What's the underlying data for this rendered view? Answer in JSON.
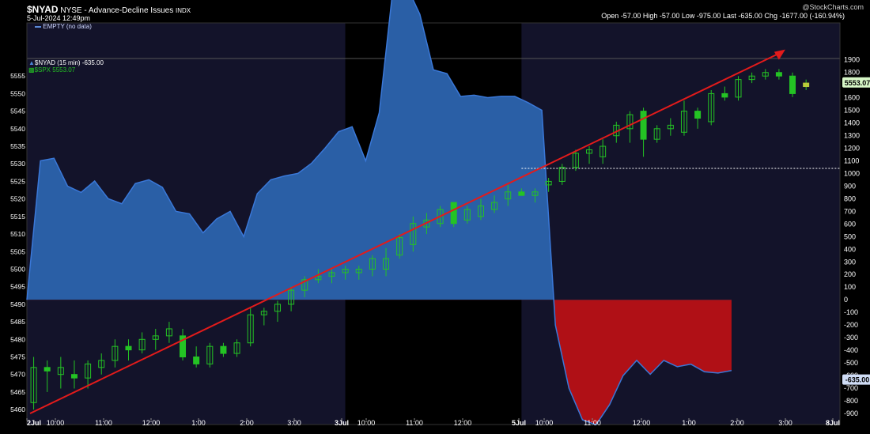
{
  "header": {
    "symbol": "$NYAD",
    "description": "NYSE - Advance-Decline Issues",
    "exchange": "INDX",
    "date": "5-Jul-2024 12:49pm",
    "ohlc": "Open -57.00   High -57.00   Low -975.00   Last -635.00   Chg -1677.00 (-160.94%)",
    "watermark": "@StockCharts.com"
  },
  "top_panel": {
    "legend": "EMPTY (no data)"
  },
  "legend": {
    "nyad": "$NYAD (15 min) -635.00",
    "spx": "$SPX 5553.07"
  },
  "colors": {
    "area_pos": "#2a5fa6",
    "area_neg": "#b01016",
    "candle_up": "#24c324",
    "trend": "#e31b1b",
    "bg_dark": "#13132a",
    "bg_black": "#000000"
  },
  "chart_data": {
    "type": "area",
    "title": "$NYAD NYSE - Advance-Decline Issues",
    "series": [
      {
        "name": "$NYAD (15 min)",
        "type": "area",
        "values": [
          0,
          1100,
          1120,
          900,
          850,
          940,
          800,
          760,
          920,
          950,
          890,
          700,
          680,
          530,
          640,
          700,
          500,
          840,
          950,
          980,
          1000,
          1080,
          1200,
          1330,
          1370,
          1100,
          1480,
          2450,
          2490,
          2260,
          1820,
          1790,
          1610,
          1620,
          1600,
          1610,
          1610,
          1560,
          1500,
          -200,
          -700,
          -950,
          -990,
          -830,
          -600,
          -480,
          -590,
          -480,
          -530,
          -510,
          -570,
          -580,
          -560
        ],
        "last": -635.0
      },
      {
        "name": "$SPX",
        "type": "candlestick",
        "candles": [
          [
            5462,
            5472,
            5460,
            5475
          ],
          [
            5472,
            5471,
            5465,
            5474
          ],
          [
            5470,
            5472,
            5466,
            5475
          ],
          [
            5470,
            5469,
            5466,
            5474
          ],
          [
            5469,
            5473,
            5466,
            5474
          ],
          [
            5472,
            5474,
            5470,
            5476
          ],
          [
            5474,
            5478,
            5472,
            5480
          ],
          [
            5478,
            5477,
            5474,
            5480
          ],
          [
            5477,
            5480,
            5476,
            5482
          ],
          [
            5480,
            5481,
            5477,
            5483
          ],
          [
            5481,
            5483,
            5479,
            5485
          ],
          [
            5481,
            5475,
            5474,
            5483
          ],
          [
            5475,
            5473,
            5472,
            5478
          ],
          [
            5473,
            5478,
            5472,
            5479
          ],
          [
            5478,
            5476,
            5475,
            5479
          ],
          [
            5476,
            5479,
            5475,
            5480
          ],
          [
            5479,
            5487,
            5478,
            5489
          ],
          [
            5487,
            5488,
            5484,
            5489
          ],
          [
            5488,
            5490,
            5485,
            5491
          ],
          [
            5490,
            5494,
            5488,
            5495
          ],
          [
            5494,
            5497,
            5492,
            5498
          ],
          [
            5497,
            5498,
            5496,
            5500
          ],
          [
            5498,
            5499,
            5496,
            5500
          ],
          [
            5499,
            5500,
            5497,
            5501
          ],
          [
            5499,
            5500,
            5497,
            5501
          ],
          [
            5500,
            5503,
            5498,
            5504
          ],
          [
            5500,
            5503,
            5498,
            5506
          ],
          [
            5504,
            5509,
            5503,
            5510
          ],
          [
            5507,
            5513,
            5505,
            5515
          ],
          [
            5512,
            5514,
            5510,
            5516
          ],
          [
            5513,
            5517,
            5512,
            5518
          ],
          [
            5519,
            5513,
            5512,
            5519
          ],
          [
            5514,
            5517,
            5513,
            5518
          ],
          [
            5515,
            5518,
            5514,
            5520
          ],
          [
            5517,
            5519,
            5516,
            5521
          ],
          [
            5520,
            5522,
            5518,
            5524
          ],
          [
            5522,
            5521,
            5521,
            5523
          ],
          [
            5521,
            5522,
            5519,
            5523
          ],
          [
            5524,
            5525,
            5522,
            5526
          ],
          [
            5525,
            5529,
            5524,
            5530
          ],
          [
            5529,
            5533,
            5528,
            5534
          ],
          [
            5533,
            5534,
            5530,
            5535
          ],
          [
            5532,
            5535,
            5530,
            5537
          ],
          [
            5538,
            5541,
            5536,
            5542
          ],
          [
            5540,
            5544,
            5536,
            5545
          ],
          [
            5545,
            5537,
            5532,
            5546
          ],
          [
            5537,
            5540,
            5536,
            5541
          ],
          [
            5540,
            5541,
            5538,
            5543
          ],
          [
            5539,
            5545,
            5538,
            5548
          ],
          [
            5545,
            5543,
            5540,
            5546
          ],
          [
            5542,
            5550,
            5541,
            5551
          ],
          [
            5550,
            5549,
            5548,
            5552
          ],
          [
            5549,
            5554,
            5548,
            5555
          ],
          [
            5554,
            5555,
            5553,
            5556
          ],
          [
            5555,
            5556,
            5554,
            5557
          ],
          [
            5556,
            5555,
            5554,
            5557
          ],
          [
            5555,
            5550,
            5549,
            5556
          ],
          [
            5552,
            5553,
            5551,
            5554
          ]
        ],
        "last": 5553.07
      }
    ],
    "trendline": {
      "from": [
        0,
        -900
      ],
      "to": [
        60,
        1950
      ]
    },
    "x_ticks": [
      "2Jul",
      "10:00",
      "11:00",
      "12:00",
      "1:00",
      "2:00",
      "3:00",
      "3Jul",
      "10:00",
      "11:00",
      "12:00",
      "5Jul",
      "10:00",
      "11:00",
      "12:00",
      "1:00",
      "2:00",
      "3:00",
      "8Jul"
    ],
    "y_left_ticks": [
      5460,
      5465,
      5470,
      5475,
      5480,
      5485,
      5490,
      5495,
      5500,
      5505,
      5510,
      5515,
      5520,
      5525,
      5530,
      5535,
      5540,
      5545,
      5550,
      5555
    ],
    "y_right_ticks": [
      1900,
      1800,
      1700,
      1600,
      1500,
      1400,
      1300,
      1200,
      1100,
      1000,
      900,
      800,
      700,
      600,
      500,
      400,
      300,
      200,
      100,
      0,
      -100,
      -200,
      -300,
      -400,
      -500,
      -600,
      -700,
      -800,
      -900
    ],
    "ylim_left": [
      5458,
      5560
    ],
    "ylim_right": [
      -925,
      1910
    ],
    "dotted_line": 1040,
    "last_labels": {
      "spx": "5553.07",
      "nyad": "-635.00"
    }
  }
}
